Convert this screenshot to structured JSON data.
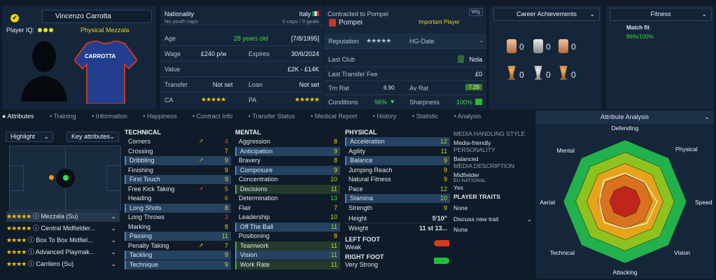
{
  "player": {
    "name": "Vincenzo Carrotta",
    "iq_label": "Player IQ:",
    "position": "Physical Mezzala",
    "shirt_name": "CARROTTA"
  },
  "info": {
    "nationality_label": "Nationality",
    "nationality": "Italy",
    "youth_caps": "No youth caps",
    "caps": "0 caps / 0 goals",
    "age_label": "Age",
    "age": "28 years old",
    "dob": "[7/8/1995]",
    "wage_label": "Wage",
    "wage": "£240 p/w",
    "expires_label": "Expires",
    "expires": "30/6/2024",
    "value_label": "Value",
    "value": "£2K - £14K",
    "transfer_label": "Transfer",
    "transfer": "Not set",
    "loan_label": "Loan",
    "loan": "Not set",
    "ca_label": "CA",
    "ca_stars": "★★★★★",
    "pa_label": "PA",
    "pa_stars": "★★★★★"
  },
  "contract": {
    "contracted_label": "Contracted to Pompei",
    "club": "Pompei",
    "role": "Important Player",
    "wtg": "Wtg",
    "reputation_label": "Reputation",
    "reputation_stars": "★★★★★",
    "hg_label": "HG-Date",
    "hg_value": "-",
    "last_club_label": "Last Club",
    "last_club": "Nola",
    "last_fee_label": "Last Transfer Fee",
    "last_fee": "£0",
    "trn_label": "Trn Rat",
    "trn": "6.90",
    "av_label": "Av Rat",
    "av": "7.26",
    "conditions_label": "Conditions",
    "conditions": "96%",
    "sharpness_label": "Sharpness",
    "sharpness": "100%"
  },
  "career": {
    "title": "Career Achievements",
    "counts": [
      "0",
      "0",
      "0",
      "0",
      "0",
      "0"
    ]
  },
  "fitness": {
    "title": "Fitness",
    "match_fit_label": "Match fit",
    "match_fit": "96%/100%"
  },
  "tabs": [
    "Attributes",
    "Training",
    "Information",
    "Happiness",
    "Contract Info",
    "Transfer Status",
    "Medical Report",
    "History",
    "Statistic",
    "Analysis"
  ],
  "tactic": {
    "highlight": "Highlight",
    "key_attributes": "Key attributes"
  },
  "roles": [
    {
      "stars": "★★★★★",
      "name": "Mezzala (Su)"
    },
    {
      "stars": "★★★★★",
      "name": "Central Midfielder..."
    },
    {
      "stars": "★★★★",
      "name": "Box To Box Midfiel..."
    },
    {
      "stars": "★★★★",
      "name": "Advanced Playmak..."
    },
    {
      "stars": "★★★★",
      "name": "Carrilero (Su)"
    }
  ],
  "technical": {
    "title": "TECHNICAL",
    "rows": [
      [
        "Corners",
        "4"
      ],
      [
        "Crossing",
        "7"
      ],
      [
        "Dribbling",
        "9"
      ],
      [
        "Finishing",
        "9"
      ],
      [
        "First Touch",
        "9"
      ],
      [
        "Free Kick Taking",
        "5"
      ],
      [
        "Heading",
        "6"
      ],
      [
        "Long Shots",
        "8"
      ],
      [
        "Long Throws",
        "3"
      ],
      [
        "Marking",
        "8"
      ],
      [
        "Passing",
        "11"
      ],
      [
        "Penalty Taking",
        "7"
      ],
      [
        "Tackling",
        "9"
      ],
      [
        "Technique",
        "9"
      ]
    ]
  },
  "mental": {
    "title": "MENTAL",
    "rows": [
      [
        "Aggression",
        "8"
      ],
      [
        "Anticipation",
        "9"
      ],
      [
        "Bravery",
        "8"
      ],
      [
        "Composure",
        "9"
      ],
      [
        "Concentration",
        "10"
      ],
      [
        "Decisions",
        "11"
      ],
      [
        "Determination",
        "13"
      ],
      [
        "Flair",
        "7"
      ],
      [
        "Leadership",
        "10"
      ],
      [
        "Off The Ball",
        "11"
      ],
      [
        "Positioning",
        "8"
      ],
      [
        "Teamwork",
        "11"
      ],
      [
        "Vision",
        "11"
      ],
      [
        "Work Rate",
        "11"
      ]
    ]
  },
  "physical": {
    "title": "PHYSICAL",
    "rows": [
      [
        "Acceleration",
        "12"
      ],
      [
        "Agility",
        "11"
      ],
      [
        "Balance",
        "9"
      ],
      [
        "Jumping Reach",
        "9"
      ],
      [
        "Natural Fitness",
        "9"
      ],
      [
        "Pace",
        "12"
      ],
      [
        "Stamina",
        "10"
      ],
      [
        "Strength",
        "9"
      ]
    ],
    "height_label": "Height",
    "height": "5'10\"",
    "weight_label": "Weight",
    "weight": "11 st 13..."
  },
  "feet": {
    "left_label": "LEFT FOOT",
    "left": "Weak",
    "right_label": "RIGHT FOOT",
    "right": "Very Strong"
  },
  "media": {
    "style_label": "MEDIA HANDLING STYLE",
    "style": "Media-friendly",
    "personality_label": "PERSONALITY",
    "personality": "Balanced",
    "desc_label": "MEDIA DESCRIPTION",
    "desc": "Midfielder",
    "eu_label": "EU NATIONAL",
    "eu": "Yes",
    "traits_label": "PLAYER TRAITS",
    "traits": "None",
    "discuss": "Discuss new trait",
    "traits2": "None"
  },
  "analysis": {
    "title": "Attribute Analysis",
    "axes": [
      "Defending",
      "Physical",
      "Speed",
      "Vision",
      "Attacking",
      "Technical",
      "Aerial",
      "Mental"
    ]
  },
  "colors": {
    "green": "#3fdc3f",
    "yellow": "#f1d019",
    "orange": "#f39c12",
    "red": "#e74c3c"
  }
}
